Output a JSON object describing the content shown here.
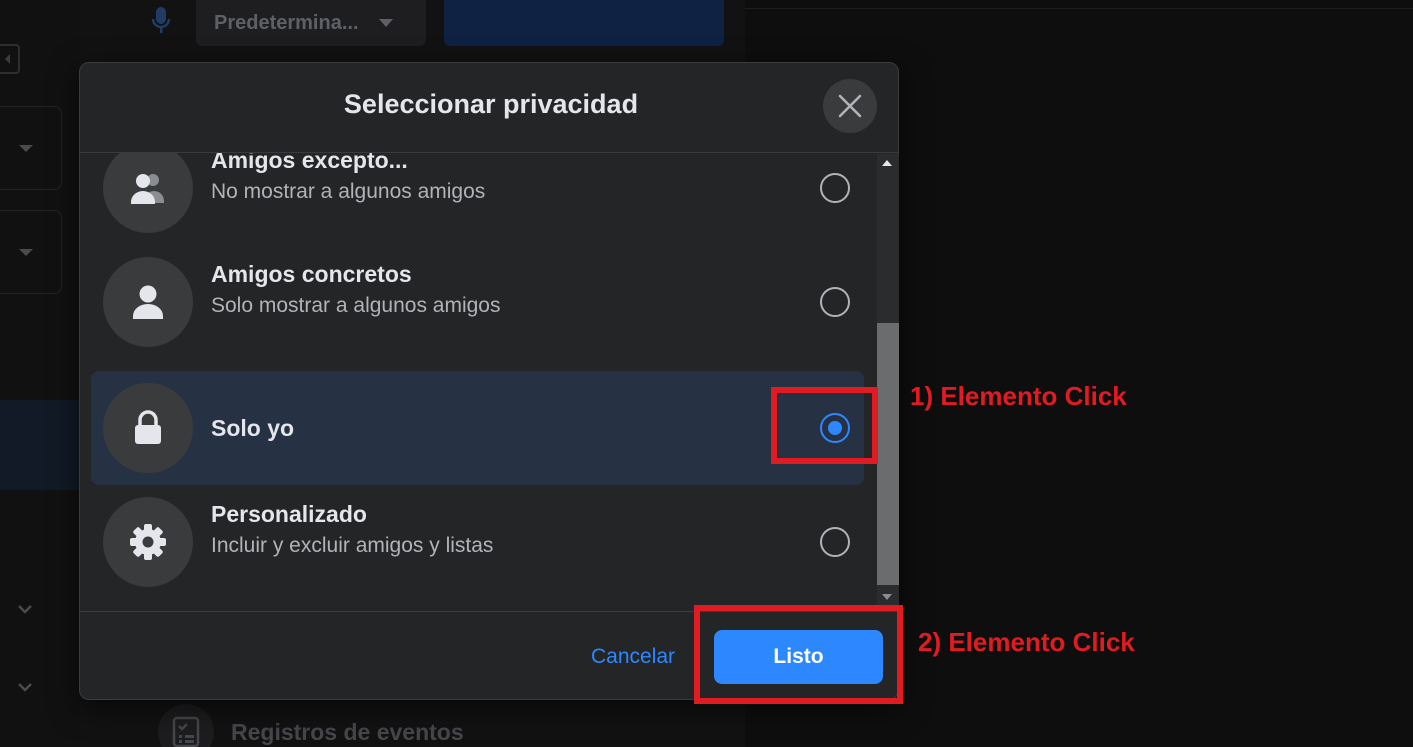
{
  "background": {
    "audience_dropdown": "Predetermina...",
    "events_label": "Registros de eventos"
  },
  "modal": {
    "title": "Seleccionar privacidad",
    "options": [
      {
        "title": "Amigos excepto...",
        "subtitle": "No mostrar a algunos amigos",
        "icon": "friends-icon",
        "selected": false
      },
      {
        "title": "Amigos concretos",
        "subtitle": "Solo mostrar a algunos amigos",
        "icon": "person-icon",
        "selected": false
      },
      {
        "title": "Solo yo",
        "subtitle": "",
        "icon": "lock-icon",
        "selected": true
      },
      {
        "title": "Personalizado",
        "subtitle": "Incluir y excluir amigos y listas",
        "icon": "gear-icon",
        "selected": false
      }
    ],
    "cancel_label": "Cancelar",
    "done_label": "Listo"
  },
  "annotations": {
    "first": "1) Elemento Click",
    "second": "2) Elemento Click"
  },
  "colors": {
    "accent": "#2d88ff",
    "annotation": "#e11b22",
    "modal_bg": "#242526",
    "selected_row": "#263244"
  }
}
